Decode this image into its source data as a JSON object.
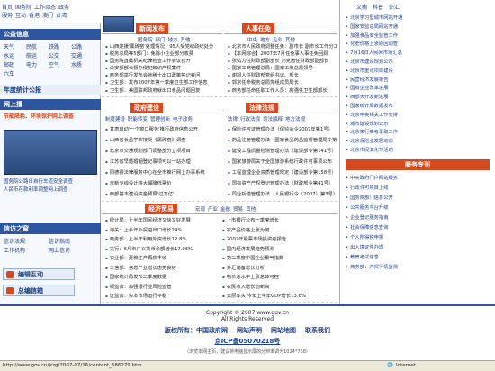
{
  "topnav": {
    "row1": [
      "首页",
      "国务院",
      "工作动态",
      "政务"
    ],
    "row2": [
      "服务",
      "互动",
      "香港",
      "澳门",
      "台湾"
    ]
  },
  "top_right_links": [
    "文摘",
    "科普",
    "外汇"
  ],
  "left": {
    "public_info_title": "公益信息",
    "public_items": [
      "天气",
      "民航",
      "铁路",
      "公路",
      "水运",
      "航运",
      "公交",
      "交通",
      "邮政",
      "电力",
      "空气",
      "水质",
      "六车"
    ],
    "stats_title": "年度统计公报",
    "online_title": "网上播",
    "online_sub": "节能降耗、环境保护网上调查",
    "online_list": [
      "国务院公路日自行车道安全调查",
      "人民币存款利率调整网上调查"
    ],
    "service_title": "信访之窗",
    "service_items": [
      "信访法规",
      "信访指南",
      "工作机构",
      "网上信访"
    ],
    "btn1": "编辑互动",
    "btn2": "总编信箱"
  },
  "sections": {
    "news": {
      "title": "新闻发布",
      "tabs": [
        "国务院",
        "部门",
        "地方",
        "其他"
      ],
      "items": [
        "山西连援'黑砖窑'处理情况：95人受党纪政纪处分",
        "税务总局等5部门：免除小企业部分收费",
        "国务院直属机关纪律检查工作会议召开",
        "公安部部长督办侵犯知识产权案件",
        "商务部举行发布会就稀土出口政策答记者问",
        "卫生部：发布2007年第一季度卫生部工作信息",
        "卫生部：美国联邦政府就出口食品问题回复"
      ]
    },
    "personnel": {
      "title": "人事任免",
      "tabs": [
        "中央",
        "地方",
        "企业",
        "其他"
      ],
      "items": [
        "北京市人民政府调整任免：副市长 副市长工作分工",
        "【本网综合】2007年7月任免事人事任免回顾",
        "张弘力任财政部副部长 刘克崮任财政部副部长",
        "国家工商管理总局：国家工商总局领导",
        "谢旭人任财政部党组书记、部长",
        "郭京任命税务总局党组成员局长",
        "商务部任命任职工作人员：高强任卫生部部长"
      ]
    },
    "gov": {
      "title": "政府建设",
      "tabs": [
        "制度建设",
        "职能转变",
        "管理创新",
        "电子政务"
      ],
      "items": [
        "甘肃启动'一个窗口服务'推行政府信息公开",
        "山西省长孟学农接受《黑砖窑》调查",
        "北京市交通规划部门调整部分立项项目",
        "江苏省早婚婚姻登记事项可以一站办理",
        "同德县法律服务中心在全市推行网上办事系统",
        "京新专线设计将大幅降低票价",
        "西部基本建设资金预算'过万亿'"
      ]
    },
    "law": {
      "title": "法律法规",
      "tabs": [
        "法律",
        "行政法规",
        "司法解释",
        "地方法规"
      ],
      "items": [
        "保险许可证管理办法（保监会令2007年第1号）",
        "药品注册管理办法（国家食品药品监督管理局令第28号）",
        "建设工程质量检测管理办法（建设部令第141号）",
        "国家旅游局关于全国旅游系统行政许可事项公布",
        "工程监理企业资质管理规定（建设部令第158号）",
        "国有资产产权登记管理办法（财政部令第41号）",
        "同业拆借管理办法（人民银行令（2007）第3号）"
      ]
    },
    "econ": {
      "title": "经济贸易",
      "tabs": [
        "宏观",
        "产业",
        "金融",
        "贸易",
        "其他"
      ],
      "items": [
        "统计局：上半年国民经济又快又好发展",
        "海关：上半年外贸进出口增长24%",
        "商务部：上半年利用外资增长12.8%",
        "央行：6月末广义货币余额增长17.06%",
        "农业部：夏粮生产再获丰收",
        "工信部：信息产业增长态势良好",
        "国家统计局发布二季度数据",
        "银监会：加强银行业风险监管",
        "证监会：资本市场运行平稳"
      ],
      "items2": [
        "上市银行公布一季度增长",
        "农产品价格上涨为何",
        "2007年股票市场投资者报告",
        "国内经济发展趋势预测",
        "第二季度中国企业景气指数",
        "外汇储备增长分析",
        "物价总水平上涨总体可控",
        "农民收入增长创新高",
        "太原车头 今年上半年GDP增长13.8%"
      ]
    }
  },
  "right": {
    "items_top": [
      "北京学习型城市网站开通",
      "国家安监总局网站开通",
      "加强食品安全监管工作",
      "化肥价格上涨原因调查",
      "7月16日人民网市场汇总",
      "北京市建设规划公示",
      "北京市重点项目建设",
      "民营经济发展报告",
      "国有企业改革进展",
      "西部大开发新进展",
      "国家统计局数据发布",
      "北京申奥相关工作安排",
      "城市建设规划公示",
      "北京举行高考录取工作",
      "北京保险业发展动态",
      "北京市民文化节活动"
    ],
    "service_title": "服务专刊",
    "items_bottom": [
      "中央政府门户网站服务",
      "行政许可项目上线",
      "国务院部门信息公开",
      "公共服务平台升级",
      "企业登记服务指南",
      "社会保障信息查询",
      "个人所得税申报",
      "出入境证件办理",
      "教育考试信息",
      "商务部：内贸行情监测"
    ]
  },
  "footer": {
    "copyright": "Copyright © 2007 www.gov.cn",
    "rights": "All Rights Reserved",
    "links": [
      "版权所有：中国政府网",
      "网站声明",
      "网站地图",
      "联系我们"
    ],
    "icp": "京ICP备05070218号",
    "note": "（浏览本网主页，建议将电脑显示屏的分辨率调为1024*768）"
  },
  "status": {
    "url": "http://www.gov.cn/jrzg/2007-07/16/content_686279.htm",
    "zone": "Internet"
  },
  "colors": {
    "accent": "#d64a1e",
    "nav": "#2e55a0"
  }
}
